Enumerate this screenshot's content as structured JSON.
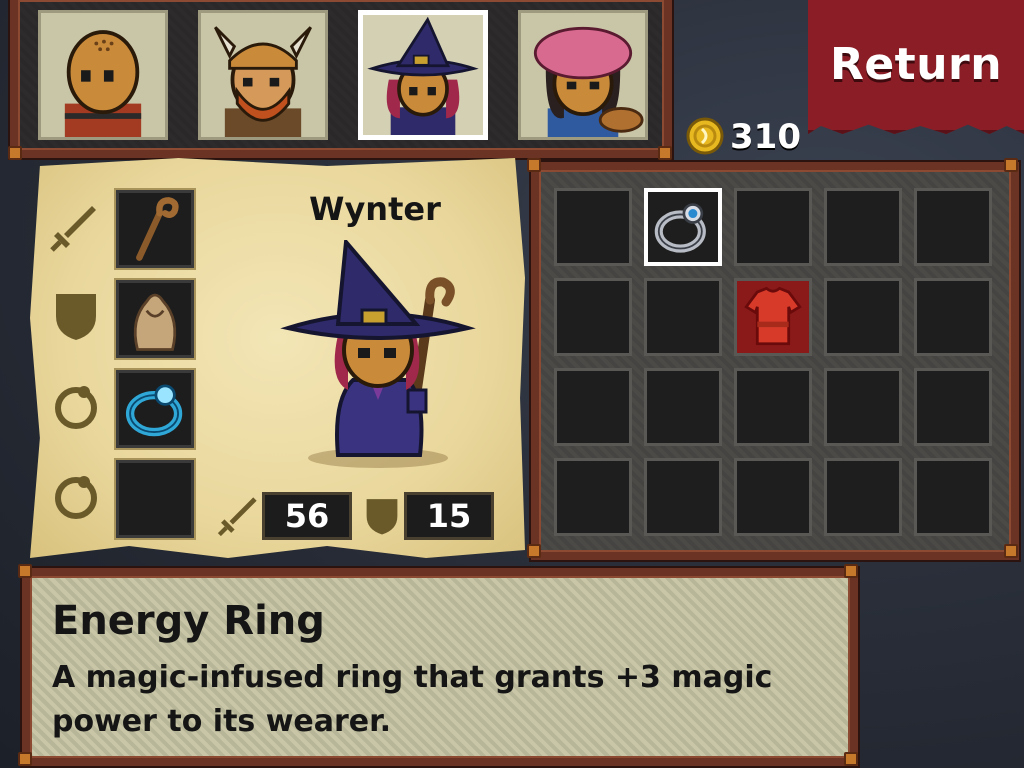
{
  "party": [
    {
      "id": "bald-hero"
    },
    {
      "id": "viking-hero"
    },
    {
      "id": "witch-hero",
      "selected": true
    },
    {
      "id": "bard-hero"
    }
  ],
  "return_label": "Return",
  "gold": "310",
  "hero": {
    "name": "Wynter",
    "attack": "56",
    "defense": "15",
    "equipment": [
      {
        "slot_icon": "sword-icon",
        "item": "staff"
      },
      {
        "slot_icon": "shield-icon",
        "item": "robe"
      },
      {
        "slot_icon": "ring-icon",
        "item": "energy-ring"
      },
      {
        "slot_icon": "ring-icon",
        "item": null
      }
    ]
  },
  "inventory": {
    "rows": 4,
    "cols": 5,
    "items": [
      {
        "row": 0,
        "col": 1,
        "item": "energy-ring",
        "selected": true
      },
      {
        "row": 1,
        "col": 2,
        "item": "red-tunic"
      }
    ]
  },
  "selected_item": {
    "name": "Energy Ring",
    "description": "A magic-infused ring that grants +3 magic power to its wearer."
  },
  "colors": {
    "return_button": "#8b1d27",
    "wood_frame": "#6b3324",
    "parchment": "#ecdba2",
    "desc_panel": "#c8c6a6",
    "gold": "#e8b820"
  }
}
